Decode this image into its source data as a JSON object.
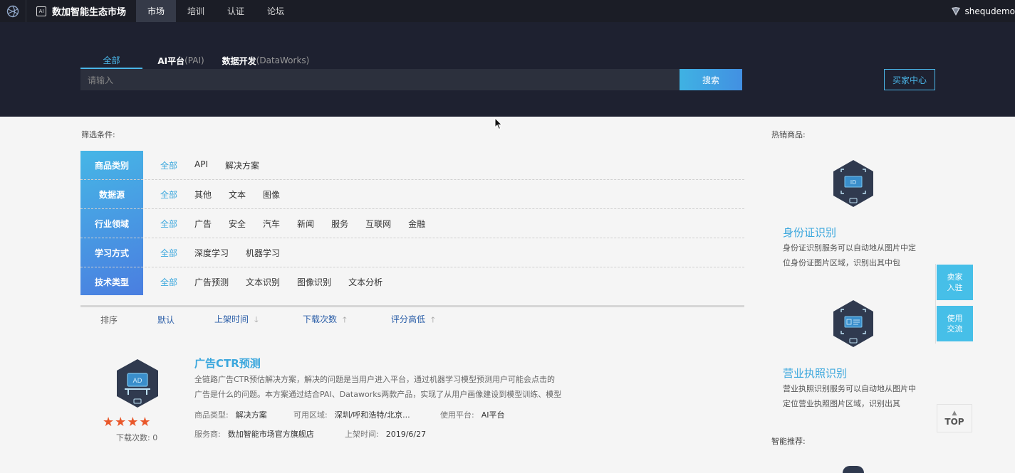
{
  "topbar": {
    "brand": "数加智能生态市场",
    "brand_badge": "AI",
    "nav": [
      "市场",
      "培训",
      "认证",
      "论坛"
    ],
    "active_nav": 0,
    "user": "shequdemo"
  },
  "hero": {
    "tabs": [
      {
        "label": "全部",
        "sub": ""
      },
      {
        "label": "AI平台",
        "sub": "(PAI)"
      },
      {
        "label": "数据开发",
        "sub": "(DataWorks)"
      }
    ],
    "active_tab": 0,
    "search_placeholder": "请输入",
    "search_button": "搜索",
    "buyer_center": "买家中心"
  },
  "filters": {
    "title": "筛选条件:",
    "rows": [
      {
        "label": "商品类别",
        "options": [
          "全部",
          "API",
          "解决方案"
        ]
      },
      {
        "label": "数据源",
        "options": [
          "全部",
          "其他",
          "文本",
          "图像"
        ]
      },
      {
        "label": "行业领域",
        "options": [
          "全部",
          "广告",
          "安全",
          "汽车",
          "新闻",
          "服务",
          "互联网",
          "金融"
        ]
      },
      {
        "label": "学习方式",
        "options": [
          "全部",
          "深度学习",
          "机器学习"
        ]
      },
      {
        "label": "技术类型",
        "options": [
          "全部",
          "广告预测",
          "文本识别",
          "图像识别",
          "文本分析"
        ]
      }
    ]
  },
  "sort": {
    "label": "排序",
    "default": "默认",
    "by_time": "上架时间",
    "by_downloads": "下载次数",
    "by_rating": "评分高低"
  },
  "product": {
    "icon_text": "AD",
    "title": "广告CTR预测",
    "desc_line1": "全链路广告CTR预估解决方案，解决的问题是当用户进入平台，通过机器学习模型预测用户可能会点击的",
    "desc_line2": "广告是什么的问题。本方案通过结合PAI、Dataworks两款产品，实现了从用户画像建设到模型训练、模型",
    "stars": "★★★★",
    "rating": 4,
    "downloads_label": "下载次数: 0",
    "type_key": "商品类型:",
    "type_val": "解决方案",
    "region_key": "可用区域:",
    "region_val": "深圳/呼和浩特/北京...",
    "platform_key": "使用平台:",
    "platform_val": "AI平台",
    "vendor_key": "服务商:",
    "vendor_val": "数加智能市场官方旗舰店",
    "date_key": "上架时间:",
    "date_val": "2019/6/27"
  },
  "sidebar": {
    "hot_title": "热销商品:",
    "hot_items": [
      {
        "name": "身份证识别",
        "desc": "身份证识别服务可以自动地从图片中定位身份证图片区域，识别出其中包"
      },
      {
        "name": "营业执照识别",
        "desc": "营业执照识别服务可以自动地从图片中定位营业执照图片区域，识别出其"
      }
    ],
    "recommend_title": "智能推荐:"
  },
  "float": {
    "seller": "卖家入驻",
    "seller_l1": "卖家",
    "seller_l2": "入驻",
    "exchange_l1": "使用",
    "exchange_l2": "交流",
    "top": "TOP"
  }
}
